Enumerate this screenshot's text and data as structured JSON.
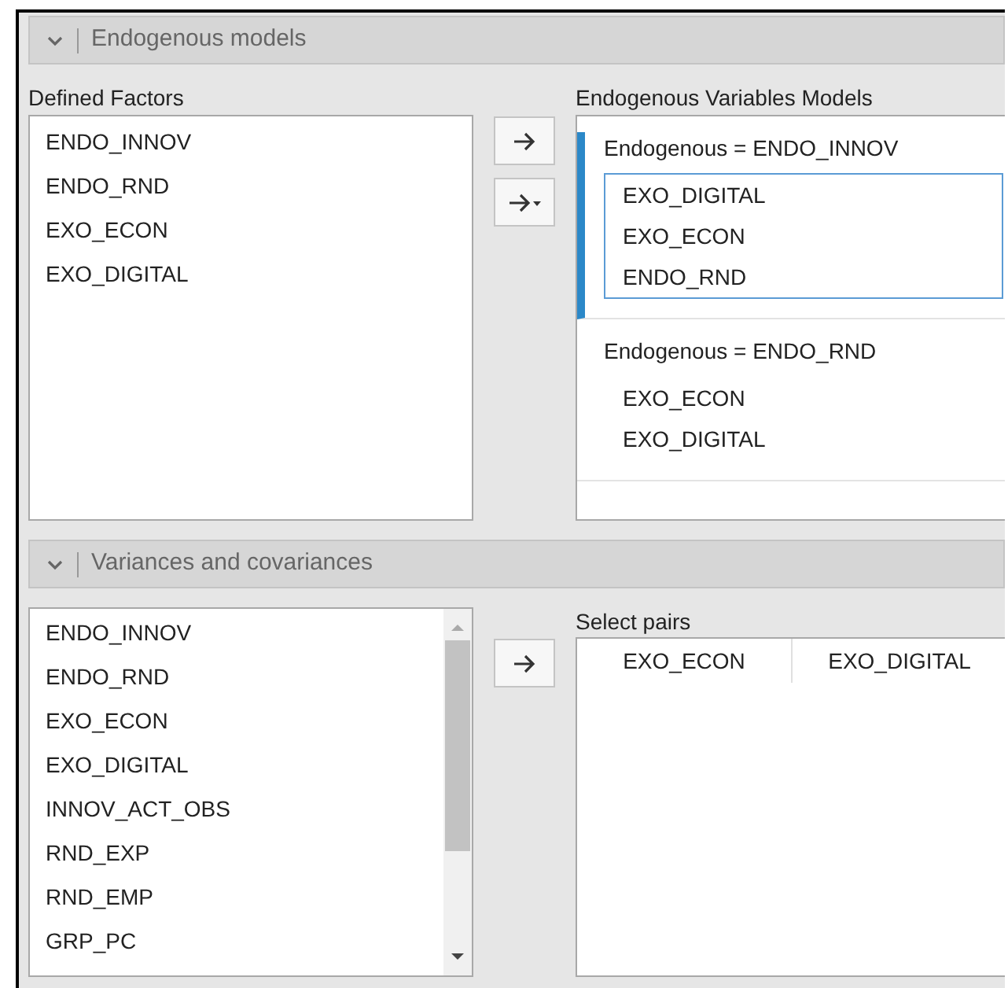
{
  "endogenous_section": {
    "title": "Endogenous models",
    "expanded": true,
    "defined_factors": {
      "label": "Defined Factors",
      "items": [
        "ENDO_INNOV",
        "ENDO_RND",
        "EXO_ECON",
        "EXO_DIGITAL"
      ]
    },
    "buttons": [
      {
        "kind": "arrow"
      },
      {
        "kind": "arrow_menu"
      }
    ],
    "models": {
      "label": "Endogenous Variables Models",
      "groups": [
        {
          "header": "Endogenous = ENDO_INNOV",
          "selected": true,
          "items": [
            "EXO_DIGITAL",
            "EXO_ECON",
            "ENDO_RND"
          ]
        },
        {
          "header": "Endogenous = ENDO_RND",
          "selected": false,
          "items": [
            "EXO_ECON",
            "EXO_DIGITAL"
          ]
        }
      ]
    }
  },
  "variances_section": {
    "title": "Variances and covariances",
    "expanded": true,
    "factors": {
      "items": [
        "ENDO_INNOV",
        "ENDO_RND",
        "EXO_ECON",
        "EXO_DIGITAL",
        "INNOV_ACT_OBS",
        "RND_EXP",
        "RND_EMP",
        "GRP_PC"
      ]
    },
    "buttons": [
      {
        "kind": "arrow"
      }
    ],
    "pairs": {
      "label": "Select pairs",
      "columns": [
        "EXO_ECON",
        "EXO_DIGITAL"
      ]
    }
  }
}
